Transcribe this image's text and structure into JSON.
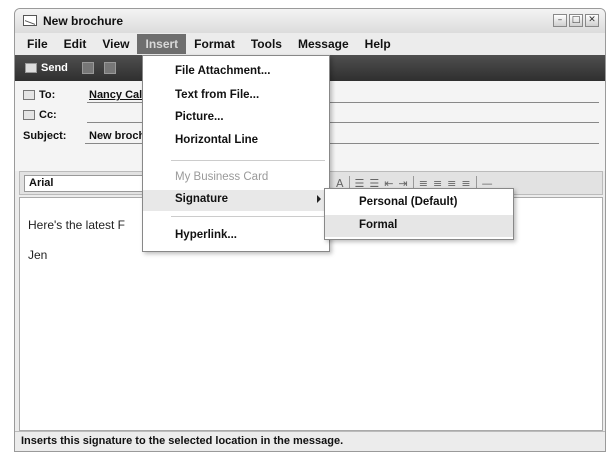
{
  "window": {
    "title": "New brochure",
    "controls": [
      "–",
      "□",
      "✕"
    ]
  },
  "menubar": {
    "items": [
      {
        "label": "File"
      },
      {
        "label": "Edit"
      },
      {
        "label": "View"
      },
      {
        "label": "Insert",
        "active": true
      },
      {
        "label": "Format"
      },
      {
        "label": "Tools"
      },
      {
        "label": "Message"
      },
      {
        "label": "Help"
      }
    ]
  },
  "toolbar": {
    "send_label": "Send"
  },
  "header": {
    "to_label": "To:",
    "to_value": "Nancy Cal",
    "cc_label": "Cc:",
    "cc_value": "",
    "subject_label": "Subject:",
    "subject_value": "New broch"
  },
  "format_bar": {
    "font": "Arial"
  },
  "message": {
    "line1": "Here's the latest F",
    "line2": "Jen"
  },
  "insert_menu": {
    "items": [
      {
        "label": "File Attachment..."
      },
      {
        "label": "Text from File..."
      },
      {
        "label": "Picture..."
      },
      {
        "label": "Horizontal Line"
      },
      {
        "label": "My Business Card",
        "disabled": true
      },
      {
        "label": "Signature",
        "submenu": true
      },
      {
        "label": "Hyperlink..."
      }
    ]
  },
  "signature_submenu": {
    "items": [
      {
        "label": "Personal (Default)"
      },
      {
        "label": "Formal"
      }
    ]
  },
  "statusbar": {
    "text": "Inserts this signature to the selected location in the message."
  },
  "colors": {
    "toolbar_bg": "#3a3a3a",
    "menu_active_bg": "#6e6e6e"
  }
}
